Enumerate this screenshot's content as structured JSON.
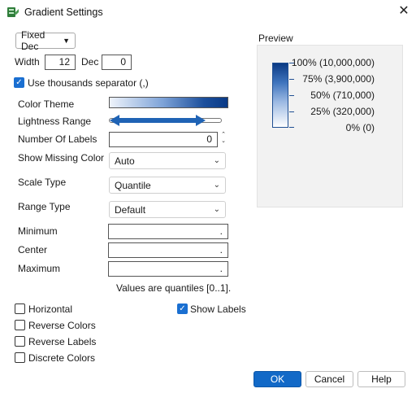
{
  "window": {
    "title": "Gradient Settings",
    "close_glyph": "✕",
    "icon": "gradient-app-icon"
  },
  "format": {
    "selected": "Fixed Dec",
    "options": [
      "Fixed Dec"
    ]
  },
  "width": {
    "label": "Width",
    "value": "12"
  },
  "dec": {
    "label": "Dec",
    "value": "0"
  },
  "thousands_sep": {
    "label": "Use thousands separator (,)",
    "checked": true
  },
  "color_theme": {
    "label": "Color Theme",
    "colors": [
      "#eef3fb",
      "#7ea3d8",
      "#1c4f9c",
      "#0a3a86"
    ]
  },
  "lightness_range": {
    "label": "Lightness Range"
  },
  "num_labels": {
    "label": "Number Of Labels",
    "value": "0"
  },
  "show_missing": {
    "label": "Show Missing Color",
    "selected": "Auto"
  },
  "scale_type": {
    "label": "Scale Type",
    "selected": "Quantile"
  },
  "range_type": {
    "label": "Range Type",
    "selected": "Default"
  },
  "minimum": {
    "label": "Minimum",
    "value": "."
  },
  "center": {
    "label": "Center",
    "value": "."
  },
  "maximum": {
    "label": "Maximum",
    "value": "."
  },
  "hint": "Values are quantiles [0..1].",
  "checkboxes": {
    "horizontal": {
      "label": "Horizontal",
      "checked": false
    },
    "reverse_colors": {
      "label": "Reverse Colors",
      "checked": false
    },
    "reverse_labels": {
      "label": "Reverse Labels",
      "checked": false
    },
    "discrete_colors": {
      "label": "Discrete Colors",
      "checked": false
    },
    "show_labels": {
      "label": "Show Labels",
      "checked": true
    }
  },
  "preview": {
    "title": "Preview",
    "legend": [
      "100% (10,000,000)",
      "75% (3,900,000)",
      "50% (710,000)",
      "25% (320,000)",
      "0% (0)"
    ],
    "accent": "#0b3a84"
  },
  "buttons": {
    "ok": "OK",
    "cancel": "Cancel",
    "help": "Help"
  }
}
